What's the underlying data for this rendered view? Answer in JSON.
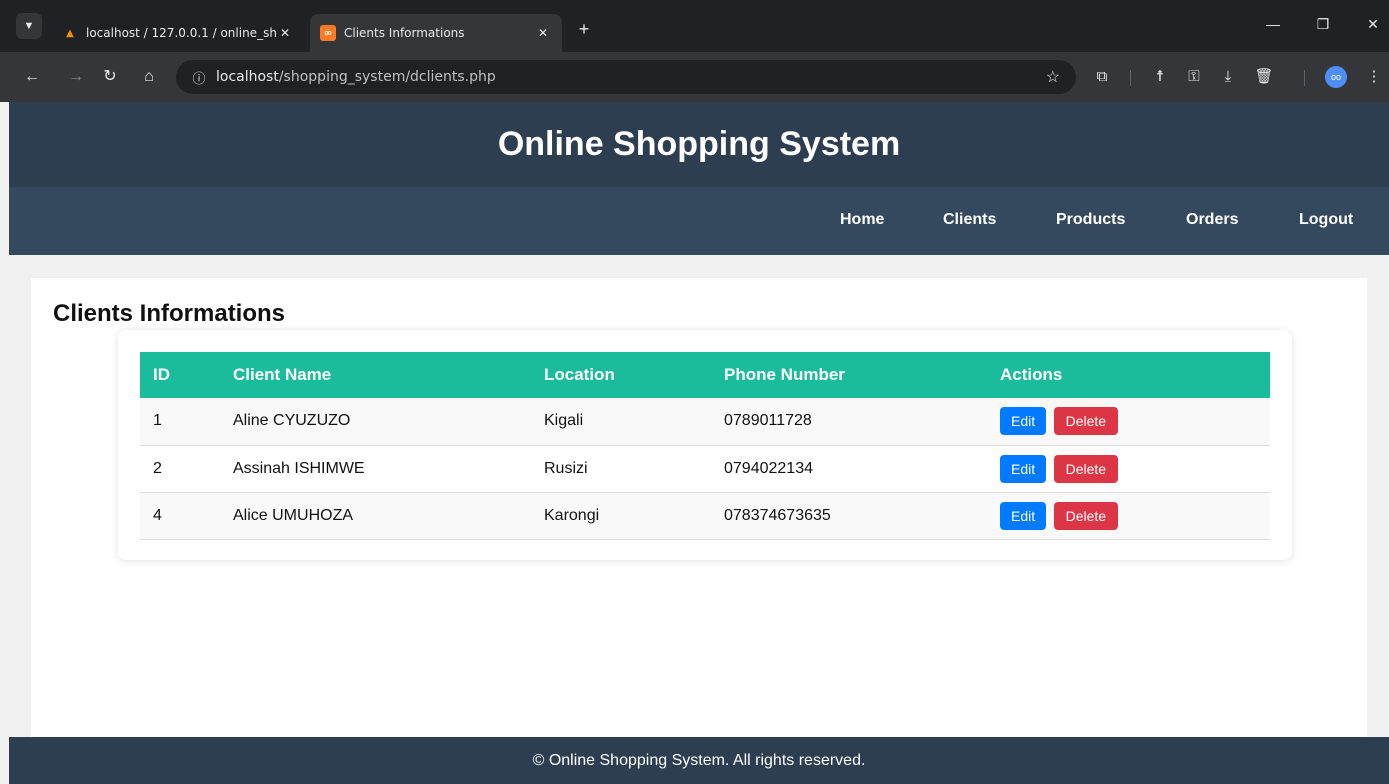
{
  "browser": {
    "tabs": [
      {
        "title": "localhost / 127.0.0.1 / online_sh",
        "favicon": "phpmyadmin-icon",
        "active": false
      },
      {
        "title": "Clients Informations",
        "favicon": "xampp-icon",
        "active": true
      }
    ],
    "url_host": "localhost",
    "url_path": "/shopping_system/dclients.php",
    "avatar_text": "oo"
  },
  "site": {
    "title": "Online Shopping System",
    "nav": [
      "Home",
      "Clients",
      "Products",
      "Orders",
      "Logout"
    ],
    "footer": "© Online Shopping System. All rights reserved."
  },
  "clients": {
    "heading": "Clients Informations",
    "columns": [
      "ID",
      "Client Name",
      "Location",
      "Phone Number",
      "Actions"
    ],
    "rows": [
      {
        "id": "1",
        "name": "Aline CYUZUZO",
        "location": "Kigali",
        "phone": "0789011728"
      },
      {
        "id": "2",
        "name": "Assinah ISHIMWE",
        "location": "Rusizi",
        "phone": "0794022134"
      },
      {
        "id": "4",
        "name": "Alice UMUHOZA",
        "location": "Karongi",
        "phone": "078374673635"
      }
    ],
    "edit_label": "Edit",
    "delete_label": "Delete"
  },
  "colors": {
    "header_bg": "#2c3e50",
    "nav_bg": "#34495e",
    "table_header": "#1abc9c",
    "edit": "#007bff",
    "delete": "#dc3545"
  }
}
